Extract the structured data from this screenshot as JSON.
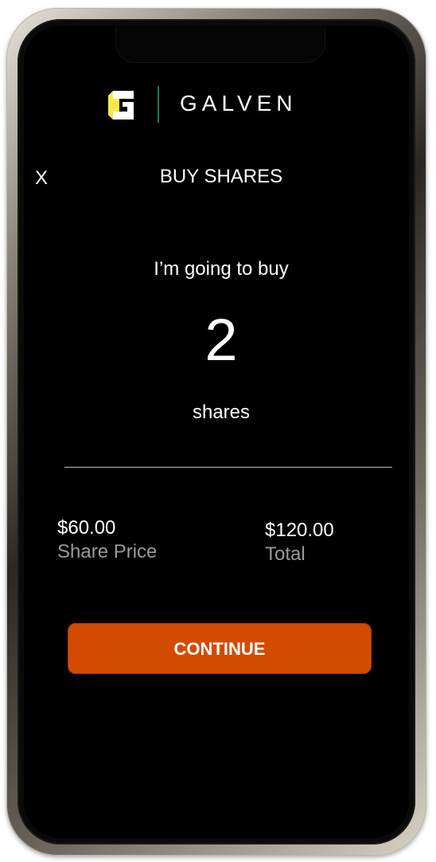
{
  "brand": {
    "name": "GALVEN",
    "logo_icon": "galven-g-logo-icon",
    "colors": {
      "logo_yellow": "#f5e94a",
      "logo_white": "#ffffff",
      "divider_green": "#1f7a4b"
    }
  },
  "header": {
    "close_label": "X",
    "title": "BUY SHARES"
  },
  "purchase": {
    "prompt": "I’m going to buy",
    "quantity": "2",
    "unit": "shares"
  },
  "summary": {
    "share_price_value": "$60.00",
    "share_price_label": "Share Price",
    "total_value": "$120.00",
    "total_label": "Total"
  },
  "actions": {
    "continue_label": "CONTINUE",
    "accent_color": "#d24b00"
  }
}
